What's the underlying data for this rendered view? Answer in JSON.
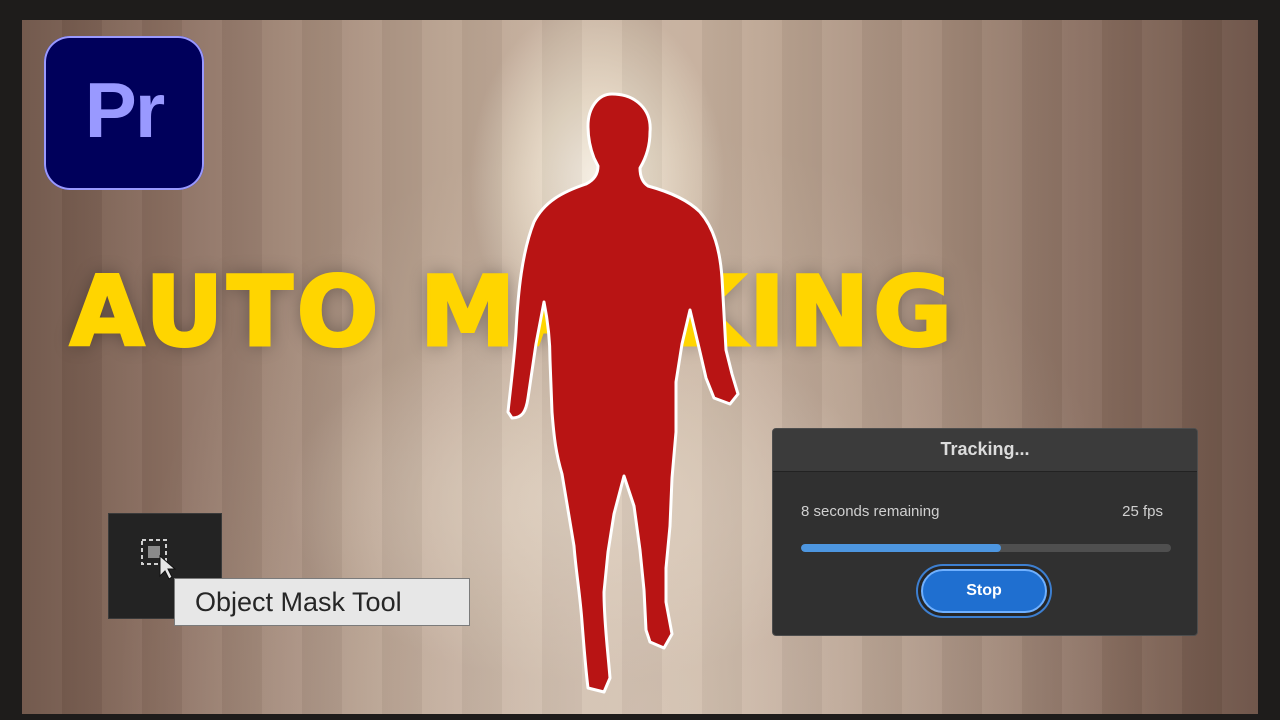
{
  "logo": {
    "text": "Pr",
    "bg_color": "#00005b",
    "text_color": "#9999ff"
  },
  "headline": {
    "text": "AUTO MASKING",
    "color": "#ffd500"
  },
  "subject": {
    "mask_color": "#b81414",
    "outline_color": "#ffffff"
  },
  "tool": {
    "icon": "object-mask-icon",
    "tooltip": "Object Mask Tool"
  },
  "tracking_dialog": {
    "title": "Tracking...",
    "status": "8 seconds remaining",
    "fps": "25 fps",
    "progress": 0.54,
    "stop_label": "Stop",
    "accent": "#1f6fd0"
  }
}
